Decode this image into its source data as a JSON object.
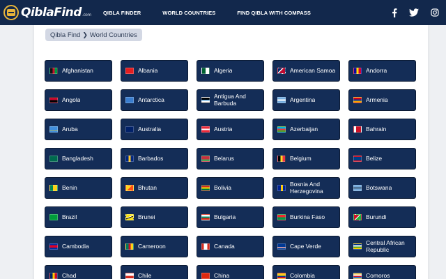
{
  "header": {
    "logo": {
      "main": "QiblaFind",
      "suffix": ".com"
    },
    "nav": [
      "QIBLA FINDER",
      "WORLD COUNTRIES",
      "FIND QIBLA WITH COMPASS"
    ],
    "social_icons": [
      "facebook-icon",
      "twitter-icon",
      "instagram-icon"
    ]
  },
  "breadcrumb": {
    "home": "Qibla Find",
    "current": "World Countries"
  },
  "colors": {
    "header_bg": "#12284c",
    "button_bg": "#142d57",
    "page_bg": "#eef0f3",
    "breadcrumb_bg": "#d3d8e4"
  },
  "countries": [
    {
      "name": "Afghanistan",
      "flag": "linear-gradient(90deg,#111 33%,#c8102e 33% 66%,#009a44 66%)"
    },
    {
      "name": "Albania",
      "flag": "#e41e20"
    },
    {
      "name": "Algeria",
      "flag": "linear-gradient(90deg,#006233 50%,#ffffff 50%)"
    },
    {
      "name": "American Samoa",
      "flag": "linear-gradient(135deg,#002868 35%,#ffffff 35% 45%,#bf0a30 45%)"
    },
    {
      "name": "Andorra",
      "flag": "linear-gradient(90deg,#10069f 33%,#fedd00 33% 66%,#d50032 66%)"
    },
    {
      "name": "Angola",
      "flag": "linear-gradient(180deg,#cc092f 50%,#000000 50%)"
    },
    {
      "name": "Antarctica",
      "flag": "#3a7dce"
    },
    {
      "name": "Antigua And Barbuda",
      "flag": "linear-gradient(180deg,#000 40%,#0072c6 40% 60%,#fff 60%)"
    },
    {
      "name": "Argentina",
      "flag": "linear-gradient(180deg,#74acdf 33%,#ffffff 33% 66%,#74acdf 66%)"
    },
    {
      "name": "Armenia",
      "flag": "linear-gradient(180deg,#d90012 33%,#0033a0 33% 66%,#f2a800 66%)"
    },
    {
      "name": "Aruba",
      "flag": "linear-gradient(180deg,#418fde 70%,#ffd100 70% 80%,#418fde 80%)"
    },
    {
      "name": "Australia",
      "flag": "#012169"
    },
    {
      "name": "Austria",
      "flag": "linear-gradient(180deg,#ed2939 33%,#ffffff 33% 66%,#ed2939 66%)"
    },
    {
      "name": "Azerbaijan",
      "flag": "linear-gradient(180deg,#00b5e2 33%,#ef3340 33% 66%,#509e2f 66%)"
    },
    {
      "name": "Bahrain",
      "flag": "linear-gradient(90deg,#ffffff 30%,#ce1126 30%)"
    },
    {
      "name": "Bangladesh",
      "flag": "#006a4e"
    },
    {
      "name": "Barbados",
      "flag": "linear-gradient(90deg,#00267f 33%,#ffc726 33% 66%,#00267f 66%)"
    },
    {
      "name": "Belarus",
      "flag": "linear-gradient(180deg,#c8313e 66%,#4aa657 66%)"
    },
    {
      "name": "Belgium",
      "flag": "linear-gradient(90deg,#000000 33%,#fdda24 33% 66%,#ef3340 66%)"
    },
    {
      "name": "Belize",
      "flag": "linear-gradient(180deg,#ce1126 15%,#003f87 15% 85%,#ce1126 85%)"
    },
    {
      "name": "Benin",
      "flag": "linear-gradient(90deg,#008751 40%,#fcd116 40%)"
    },
    {
      "name": "Bhutan",
      "flag": "linear-gradient(135deg,#ffd520 50%,#ff4e12 50%)"
    },
    {
      "name": "Bolivia",
      "flag": "linear-gradient(180deg,#d52b1e 33%,#f9e300 33% 66%,#007934 66%)"
    },
    {
      "name": "Bosnia And Herzegovina",
      "flag": "linear-gradient(90deg,#002395 40%,#fecb00 40% 70%,#002395 70%)"
    },
    {
      "name": "Botswana",
      "flag": "linear-gradient(180deg,#75aadb 40%,#ffffff 40% 45%,#000 45% 55%,#fff 55% 60%,#75aadb 60%)"
    },
    {
      "name": "Brazil",
      "flag": "#009c3b"
    },
    {
      "name": "Brunei",
      "flag": "linear-gradient(160deg,#f7e017 40%,#ffffff 40% 50%,#000000 50% 60%,#f7e017 60%)"
    },
    {
      "name": "Bulgaria",
      "flag": "linear-gradient(180deg,#ffffff 33%,#00966e 33% 66%,#d62612 66%)"
    },
    {
      "name": "Burkina Faso",
      "flag": "linear-gradient(180deg,#ef2b2d 50%,#009e49 50%)"
    },
    {
      "name": "Burundi",
      "flag": "linear-gradient(135deg,#ce1126 45%,#ffffff 45% 55%,#1eb53a 55%)"
    },
    {
      "name": "Cambodia",
      "flag": "linear-gradient(180deg,#032ea1 25%,#e00025 25% 75%,#032ea1 75%)"
    },
    {
      "name": "Cameroon",
      "flag": "linear-gradient(90deg,#007a5e 33%,#ce1126 33% 66%,#fcd116 66%)"
    },
    {
      "name": "Canada",
      "flag": "linear-gradient(90deg,#d52b1e 25%,#ffffff 25% 75%,#d52b1e 75%)"
    },
    {
      "name": "Cape Verde",
      "flag": "linear-gradient(180deg,#003893 55%,#ffffff 55% 62%,#cf2027 62% 70%,#fff 70% 77%,#003893 77%)"
    },
    {
      "name": "Central African Republic",
      "flag": "linear-gradient(180deg,#003082 25%,#ffffff 25% 50%,#289728 50% 75%,#ffce00 75%)"
    },
    {
      "name": "Chad",
      "flag": "linear-gradient(90deg,#002664 33%,#fecb00 33% 66%,#c60c30 66%)"
    },
    {
      "name": "Chile",
      "flag": "linear-gradient(180deg,#ffffff 50%,#d52b1e 50%)"
    },
    {
      "name": "China",
      "flag": "#de2910"
    },
    {
      "name": "Colombia",
      "flag": "linear-gradient(180deg,#fcd116 50%,#003893 50% 75%,#ce1126 75%)"
    },
    {
      "name": "Comoros",
      "flag": "linear-gradient(180deg,#ffc61e 25%,#ffffff 25% 50%,#ce1126 50% 75%,#3a75c4 75%)"
    }
  ]
}
